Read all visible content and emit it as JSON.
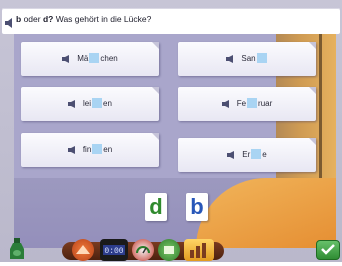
{
  "question": {
    "letter_b": "b",
    "oder": "oder",
    "letter_d": "d?",
    "rest": "Was gehört in die Lücke?"
  },
  "cards": [
    {
      "before": "Mä",
      "after": "chen"
    },
    {
      "before": "San",
      "after": ""
    },
    {
      "before": "lei",
      "after": "en"
    },
    {
      "before": "Fe",
      "after": "ruar"
    },
    {
      "before": "fin",
      "after": "en"
    },
    {
      "before": "Er",
      "after": "e"
    }
  ],
  "tiles": {
    "d": "d",
    "b": "b"
  },
  "toolbar": {
    "items": [
      "exit-icon",
      "clock-icon",
      "gauge-icon",
      "map-icon",
      "stats-icon"
    ]
  },
  "colors": {
    "gap": "#a9d4f3",
    "panel": "#a9a6cb",
    "tile_d": "#2f8a2d",
    "tile_b": "#2857b9",
    "check": "#2f8d33"
  }
}
